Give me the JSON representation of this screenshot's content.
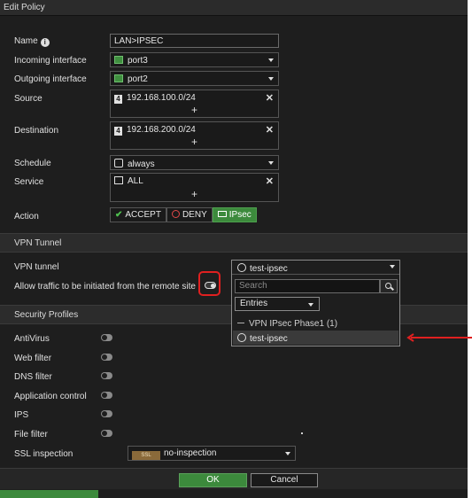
{
  "window": {
    "title": "Edit Policy"
  },
  "form": {
    "name_label": "Name",
    "name_value": "LAN>IPSEC",
    "incoming_label": "Incoming interface",
    "incoming_value": "port3",
    "outgoing_label": "Outgoing interface",
    "outgoing_value": "port2",
    "source_label": "Source",
    "source_value": "192.168.100.0/24",
    "destination_label": "Destination",
    "destination_value": "192.168.200.0/24",
    "schedule_label": "Schedule",
    "schedule_value": "always",
    "service_label": "Service",
    "service_value": "ALL",
    "action_label": "Action",
    "actions": [
      "ACCEPT",
      "DENY",
      "IPsec"
    ],
    "action_selected": "IPsec"
  },
  "vpn": {
    "section_title": "VPN Tunnel",
    "tunnel_label": "VPN tunnel",
    "tunnel_value": "test-ipsec",
    "allow_remote_label": "Allow traffic to be initiated from the remote site",
    "allow_remote_enabled": true
  },
  "dropdown": {
    "selected": "test-ipsec",
    "search_placeholder": "Search",
    "filter_value": "Entries",
    "group_label": "VPN IPsec Phase1",
    "group_count": "(1)",
    "options": [
      "test-ipsec"
    ]
  },
  "security": {
    "section_title": "Security Profiles",
    "profiles": [
      {
        "label": "AntiVirus",
        "enabled": false
      },
      {
        "label": "Web filter",
        "enabled": false
      },
      {
        "label": "DNS filter",
        "enabled": false
      },
      {
        "label": "Application control",
        "enabled": false
      },
      {
        "label": "IPS",
        "enabled": false
      },
      {
        "label": "File filter",
        "enabled": false
      }
    ],
    "ssl_label": "SSL inspection",
    "ssl_badge": "SSL",
    "ssl_value": "no-inspection"
  },
  "footer": {
    "ok_label": "OK",
    "cancel_label": "Cancel"
  },
  "colors": {
    "accent_green": "#3c8a3c",
    "highlight_red": "#e02020",
    "background": "#1e1e1e"
  }
}
